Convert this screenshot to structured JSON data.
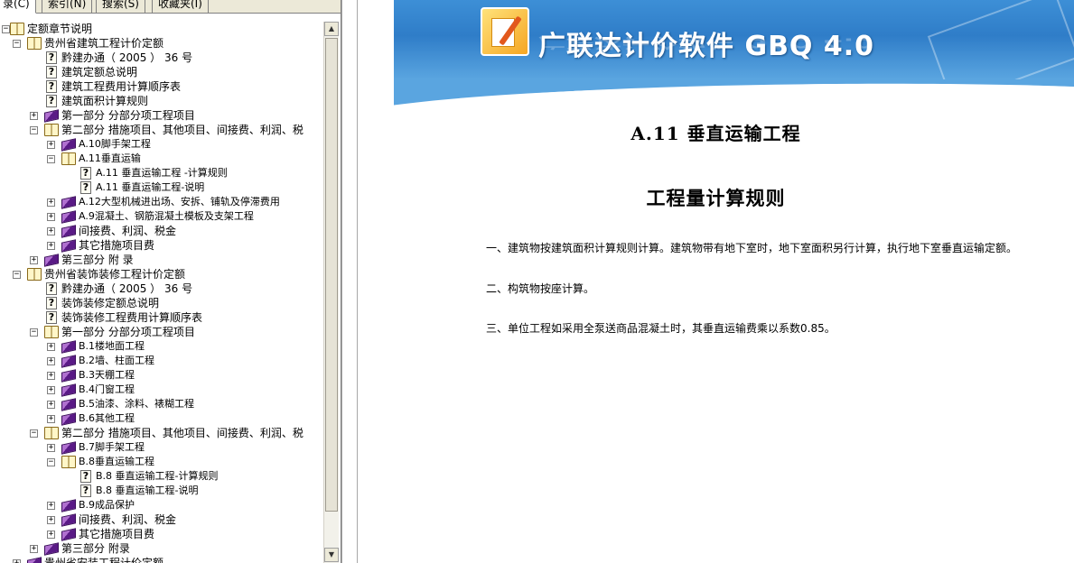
{
  "tabs": [
    {
      "label": "录(C)",
      "active": true
    },
    {
      "label": "索引(N)",
      "active": false
    },
    {
      "label": "搜索(S)",
      "active": false
    },
    {
      "label": "收藏夹(I)",
      "active": false
    }
  ],
  "tree": [
    {
      "label": "定额章节说明",
      "level": 0,
      "toggle": "−",
      "icon": "open-book"
    },
    {
      "label": "贵州省建筑工程计价定额",
      "level": 1,
      "toggle": "−",
      "icon": "open-book"
    },
    {
      "label": "黔建办通（ 2005 ） 36 号",
      "level": 2,
      "toggle": "",
      "icon": "help-page"
    },
    {
      "label": "建筑定额总说明",
      "level": 2,
      "toggle": "",
      "icon": "help-page"
    },
    {
      "label": "建筑工程费用计算顺序表",
      "level": 2,
      "toggle": "",
      "icon": "help-page"
    },
    {
      "label": "建筑面积计算规则",
      "level": 2,
      "toggle": "",
      "icon": "help-page"
    },
    {
      "label": "第一部分      分部分项工程项目",
      "level": 2,
      "toggle": "+",
      "icon": "closed-book"
    },
    {
      "label": "第二部分      措施项目、其他项目、间接费、利润、税",
      "level": 2,
      "toggle": "−",
      "icon": "open-book"
    },
    {
      "label": "A.10脚手架工程",
      "level": 3,
      "toggle": "+",
      "icon": "closed-book"
    },
    {
      "label": "A.11垂直运输",
      "level": 3,
      "toggle": "−",
      "icon": "open-book"
    },
    {
      "label": "A.11 垂直运输工程 -计算规则",
      "level": 4,
      "toggle": "",
      "icon": "help-page"
    },
    {
      "label": "A.11 垂直运输工程-说明",
      "level": 4,
      "toggle": "",
      "icon": "help-page"
    },
    {
      "label": "A.12大型机械进出场、安拆、铺轨及停滞费用",
      "level": 3,
      "toggle": "+",
      "icon": "closed-book"
    },
    {
      "label": "A.9混凝土、钢筋混凝土模板及支架工程",
      "level": 3,
      "toggle": "+",
      "icon": "closed-book"
    },
    {
      "label": "间接费、利润、税金",
      "level": 3,
      "toggle": "+",
      "icon": "closed-book"
    },
    {
      "label": "其它措施项目费",
      "level": 3,
      "toggle": "+",
      "icon": "closed-book"
    },
    {
      "label": "第三部分      附    录",
      "level": 2,
      "toggle": "+",
      "icon": "closed-book"
    },
    {
      "label": "贵州省装饰装修工程计价定额",
      "level": 1,
      "toggle": "−",
      "icon": "open-book"
    },
    {
      "label": "黔建办通（ 2005 ） 36 号",
      "level": 2,
      "toggle": "",
      "icon": "help-page"
    },
    {
      "label": "装饰装修定额总说明",
      "level": 2,
      "toggle": "",
      "icon": "help-page"
    },
    {
      "label": "装饰装修工程费用计算顺序表",
      "level": 2,
      "toggle": "",
      "icon": "help-page"
    },
    {
      "label": "第一部分      分部分项工程项目",
      "level": 2,
      "toggle": "−",
      "icon": "open-book"
    },
    {
      "label": "B.1楼地面工程",
      "level": 3,
      "toggle": "+",
      "icon": "closed-book"
    },
    {
      "label": "B.2墙、柱面工程",
      "level": 3,
      "toggle": "+",
      "icon": "closed-book"
    },
    {
      "label": "B.3天棚工程",
      "level": 3,
      "toggle": "+",
      "icon": "closed-book"
    },
    {
      "label": "B.4门窗工程",
      "level": 3,
      "toggle": "+",
      "icon": "closed-book"
    },
    {
      "label": "B.5油漆、涂料、裱糊工程",
      "level": 3,
      "toggle": "+",
      "icon": "closed-book"
    },
    {
      "label": "B.6其他工程",
      "level": 3,
      "toggle": "+",
      "icon": "closed-book"
    },
    {
      "label": "第二部分      措施项目、其他项目、间接费、利润、税",
      "level": 2,
      "toggle": "−",
      "icon": "open-book"
    },
    {
      "label": "B.7脚手架工程",
      "level": 3,
      "toggle": "+",
      "icon": "closed-book"
    },
    {
      "label": "B.8垂直运输工程",
      "level": 3,
      "toggle": "−",
      "icon": "open-book"
    },
    {
      "label": "B.8 垂直运输工程-计算规则",
      "level": 4,
      "toggle": "",
      "icon": "help-page"
    },
    {
      "label": "B.8 垂直运输工程-说明",
      "level": 4,
      "toggle": "",
      "icon": "help-page"
    },
    {
      "label": "B.9成品保护",
      "level": 3,
      "toggle": "+",
      "icon": "closed-book"
    },
    {
      "label": "间接费、利润、税金",
      "level": 3,
      "toggle": "+",
      "icon": "closed-book"
    },
    {
      "label": "其它措施项目费",
      "level": 3,
      "toggle": "+",
      "icon": "closed-book"
    },
    {
      "label": "第三部分      附录",
      "level": 2,
      "toggle": "+",
      "icon": "closed-book"
    },
    {
      "label": "贵州省安装工程计价定额",
      "level": 1,
      "toggle": "+",
      "icon": "closed-book"
    }
  ],
  "banner": {
    "title": "广联达计价软件 GBQ 4.0"
  },
  "doc": {
    "heading": "A.11  垂直运输工程",
    "subheading": "工程量计算规则",
    "paragraphs": [
      "一、建筑物按建筑面积计算规则计算。建筑物带有地下室时，地下室面积另行计算，执行地下室垂直运输定额。",
      "二、构筑物按座计算。",
      "三、单位工程如采用全泵送商品混凝土时，其垂直运输费乘以系数0.85。"
    ]
  },
  "colors": {
    "banner_blue": "#2f7dc8",
    "book_purple": "#5a1a86",
    "open_book": "#fff6c8"
  }
}
